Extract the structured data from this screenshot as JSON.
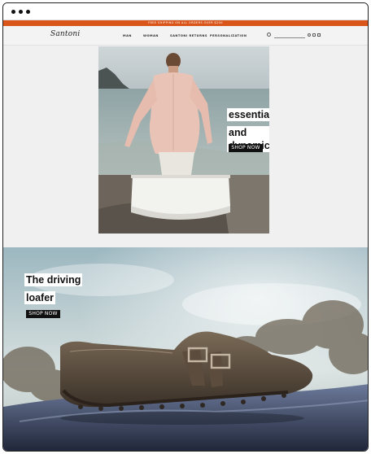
{
  "promo": {
    "text": "FREE SHIPPING ON ALL ORDERS OVER $200"
  },
  "header": {
    "brand": "Santoni",
    "nav": [
      "MAN",
      "WOMAN",
      "SANTONI RETURNS",
      "PERSONALIZATION"
    ],
    "search_placeholder": ""
  },
  "hero_primary": {
    "headline_1": "essential",
    "headline_2": "and dynamic",
    "cta": "SHOP NOW"
  },
  "hero_secondary": {
    "headline_1": "The driving",
    "headline_2": "loafer",
    "cta": "SHOP NOW"
  },
  "colors": {
    "accent": "#d9551a",
    "button": "#111111"
  }
}
